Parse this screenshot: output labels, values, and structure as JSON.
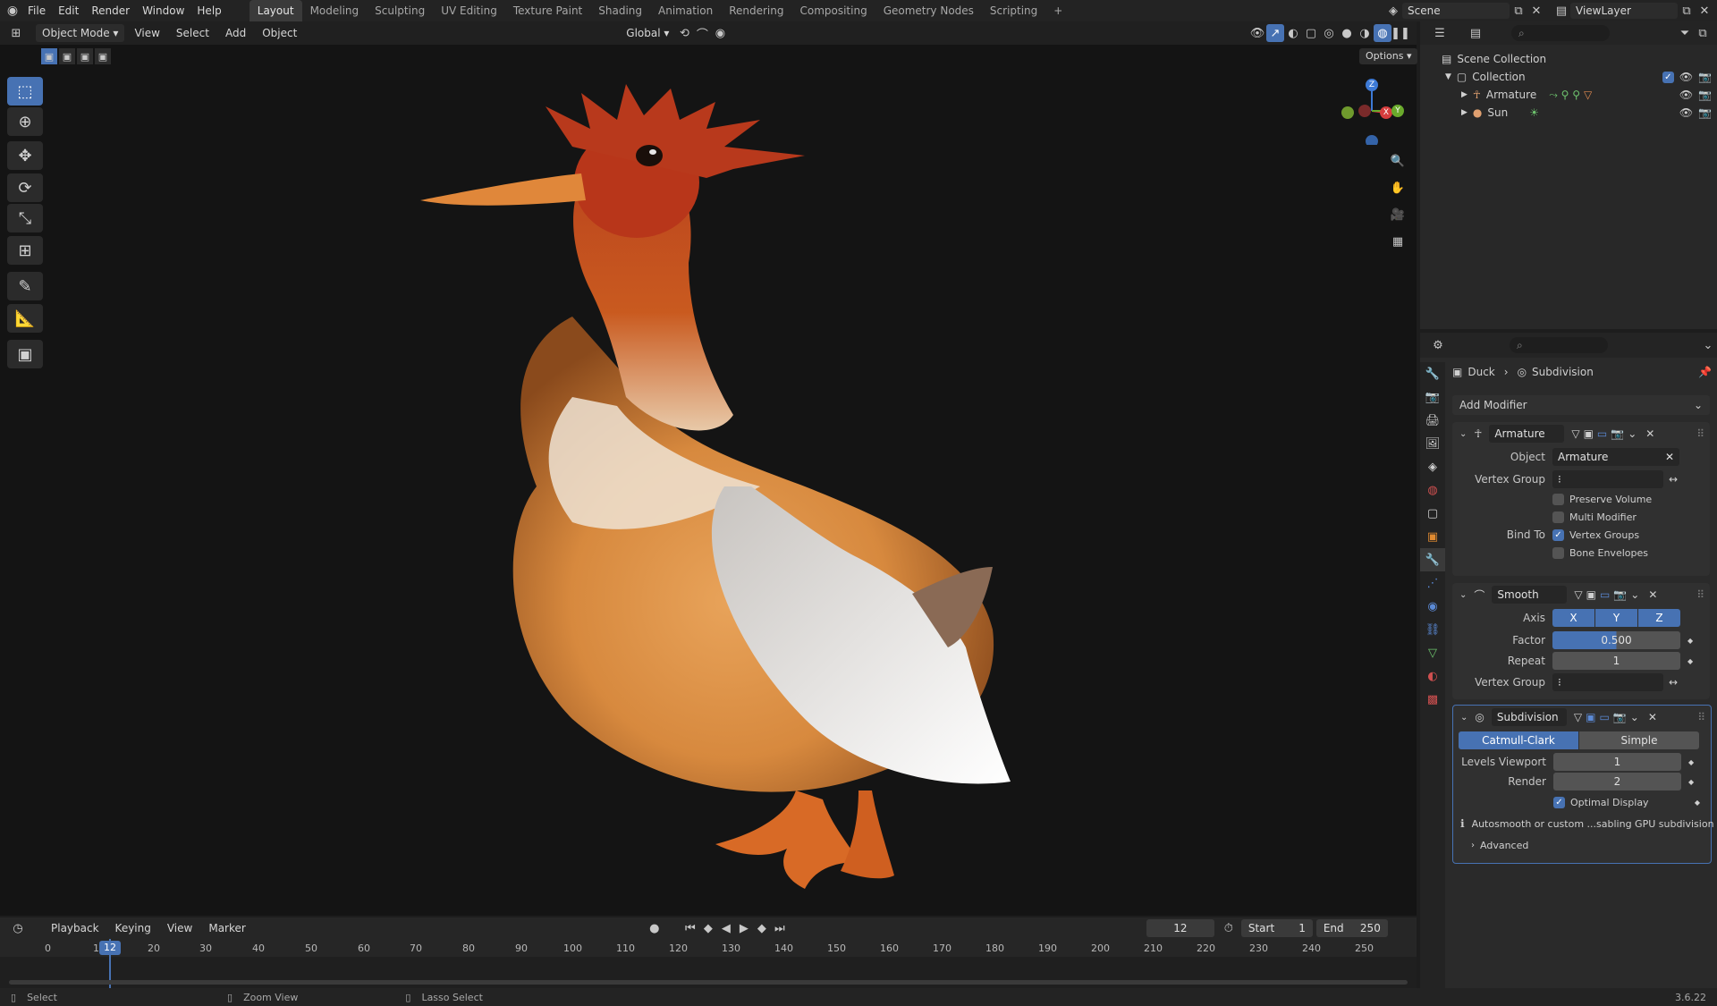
{
  "topbar": {
    "menus": [
      "File",
      "Edit",
      "Render",
      "Window",
      "Help"
    ],
    "workspaces": [
      "Layout",
      "Modeling",
      "Sculpting",
      "UV Editing",
      "Texture Paint",
      "Shading",
      "Animation",
      "Rendering",
      "Compositing",
      "Geometry Nodes",
      "Scripting"
    ],
    "active_workspace": "Layout",
    "add_tab": "+",
    "scene": "Scene",
    "view_layer": "ViewLayer"
  },
  "viewport_header": {
    "mode": "Object Mode",
    "menus": [
      "View",
      "Select",
      "Add",
      "Object"
    ],
    "transform_orientation": "Global",
    "options": "Options"
  },
  "gizmo": {
    "z": "Z",
    "x": "X",
    "y": "Y"
  },
  "outliner": {
    "scene_collection": "Scene Collection",
    "collection": "Collection",
    "items": [
      {
        "name": "Armature"
      },
      {
        "name": "Sun"
      }
    ]
  },
  "properties": {
    "breadcrumb_object": "Duck",
    "breadcrumb_modifier": "Subdivision",
    "add_modifier": "Add Modifier",
    "armature": {
      "name": "Armature",
      "object_label": "Object",
      "object_value": "Armature",
      "vertex_group_label": "Vertex Group",
      "preserve_volume": "Preserve Volume",
      "multi_modifier": "Multi Modifier",
      "bind_to_label": "Bind To",
      "vertex_groups": "Vertex Groups",
      "bone_envelopes": "Bone Envelopes"
    },
    "smooth": {
      "name": "Smooth",
      "axis_label": "Axis",
      "axes": [
        "X",
        "Y",
        "Z"
      ],
      "factor_label": "Factor",
      "factor": "0.500",
      "repeat_label": "Repeat",
      "repeat": "1",
      "vertex_group_label": "Vertex Group"
    },
    "subdivision": {
      "name": "Subdivision",
      "catmull": "Catmull-Clark",
      "simple": "Simple",
      "levels_viewport_label": "Levels Viewport",
      "levels_viewport": "1",
      "render_label": "Render",
      "render": "2",
      "optimal_display": "Optimal Display",
      "info": "Autosmooth or custom ...sabling GPU subdivision",
      "advanced": "Advanced"
    }
  },
  "timeline": {
    "menus": [
      "Playback",
      "Keying",
      "View",
      "Marker"
    ],
    "current_frame": "12",
    "start_label": "Start",
    "start": "1",
    "end_label": "End",
    "end": "250",
    "ticks": [
      "0",
      "10",
      "20",
      "30",
      "40",
      "50",
      "60",
      "70",
      "80",
      "90",
      "100",
      "110",
      "120",
      "130",
      "140",
      "150",
      "160",
      "170",
      "180",
      "190",
      "200",
      "210",
      "220",
      "230",
      "240",
      "250"
    ],
    "playhead": "12"
  },
  "statusbar": {
    "select": "Select",
    "zoom": "Zoom View",
    "lasso": "Lasso Select",
    "version": "3.6.22"
  },
  "colors": {
    "accent": "#4772b3",
    "background": "#141414"
  }
}
